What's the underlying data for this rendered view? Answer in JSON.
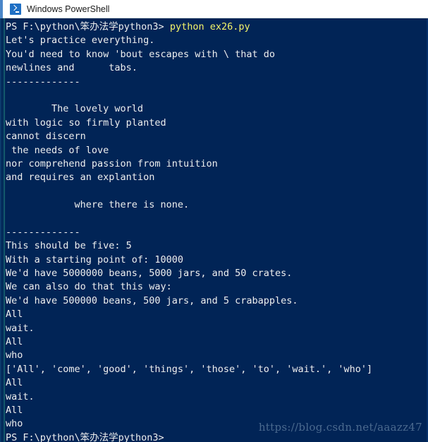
{
  "window": {
    "title": "Windows PowerShell",
    "icon": "powershell-icon",
    "background_color": "#012456",
    "text_color": "#eeeeee",
    "command_color": "#f5f56a",
    "titlebar_background": "#ffffff",
    "titlebar_text_color": "#1a1a1a"
  },
  "terminal": {
    "prompt": "PS F:\\python\\笨办法学python3>",
    "command": " python ex26.py",
    "lines": [
      "Let's practice everything.",
      "You'd need to know 'bout escapes with \\ that do",
      "newlines and      tabs.",
      "-------------",
      "",
      "        The lovely world",
      "with logic so firmly planted",
      "cannot discern",
      " the needs of love",
      "nor comprehend passion from intuition",
      "and requires an explantion",
      "",
      "            where there is none.",
      "",
      "-------------",
      "This should be five: 5",
      "With a starting point of: 10000",
      "We'd have 5000000 beans, 5000 jars, and 50 crates.",
      "We can also do that this way:",
      "We'd have 500000 beans, 500 jars, and 5 crabapples.",
      "All",
      "wait.",
      "All",
      "who",
      "['All', 'come', 'good', 'things', 'those', 'to', 'wait.', 'who']",
      "All",
      "wait.",
      "All",
      "who"
    ],
    "final_prompt": "PS F:\\python\\笨办法学python3>"
  },
  "watermark": {
    "text": "https://blog.csdn.net/aaazz47",
    "color": "#4b6a8f"
  }
}
